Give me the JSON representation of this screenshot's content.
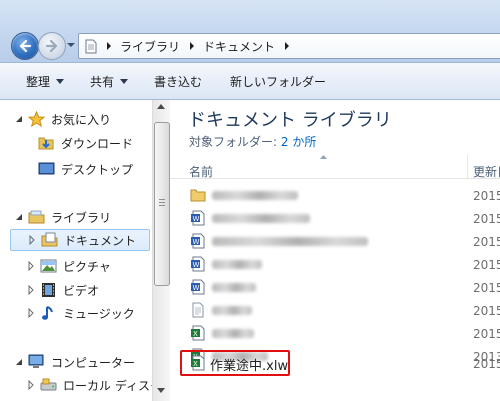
{
  "address": {
    "crumbs": [
      "ライブラリ",
      "ドキュメント"
    ]
  },
  "toolbar": {
    "organize": "整理",
    "share": "共有",
    "burn": "書き込む",
    "new_folder": "新しいフォルダー"
  },
  "nav": {
    "favorites": "お気に入り",
    "downloads": "ダウンロード",
    "desktop": "デスクトップ",
    "libraries": "ライブラリ",
    "documents": "ドキュメント",
    "pictures": "ピクチャ",
    "videos": "ビデオ",
    "music": "ミュージック",
    "computer": "コンピューター",
    "local_disk": "ローカル ディスク"
  },
  "content": {
    "title": "ドキュメント ライブラリ",
    "sub_label": "対象フォルダー:",
    "sub_link": "2 か所",
    "col_name": "名前",
    "col_date": "更新日",
    "files": [
      {
        "icon": "folder-icon",
        "date": "2015"
      },
      {
        "icon": "word-doc-icon",
        "date": "2015"
      },
      {
        "icon": "word-doc-icon",
        "date": "2015"
      },
      {
        "icon": "word-doc-icon",
        "date": "2015"
      },
      {
        "icon": "word-doc-icon",
        "date": "2015"
      },
      {
        "icon": "text-file-icon",
        "date": "2015"
      },
      {
        "icon": "excel-file-icon",
        "date": "2015"
      },
      {
        "icon": "excel-file-icon",
        "date": "2013"
      },
      {
        "icon": "excel-file-icon",
        "date": "2015",
        "name": "作業途中.xlw"
      }
    ]
  },
  "colors": {
    "title_green": "#1e395b",
    "link_blue": "#0066cc",
    "highlight_red": "#e01010"
  }
}
